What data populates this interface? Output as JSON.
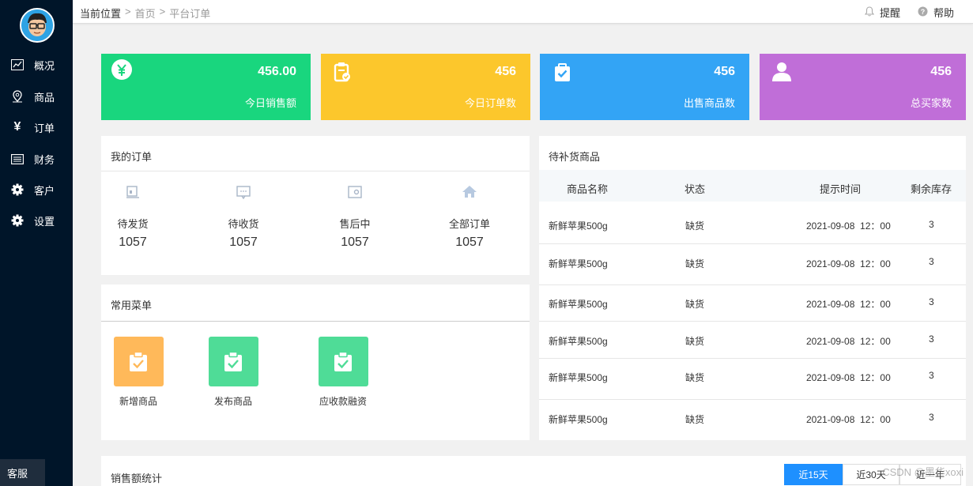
{
  "sidebar": {
    "items": [
      {
        "label": "概况",
        "icon": "chart-line-icon"
      },
      {
        "label": "商品",
        "icon": "map-pin-icon"
      },
      {
        "label": "订单",
        "icon": "yen-icon"
      },
      {
        "label": "财务",
        "icon": "list-icon"
      },
      {
        "label": "客户",
        "icon": "gear-icon"
      },
      {
        "label": "设置",
        "icon": "gear-icon"
      }
    ],
    "kefu": "客服"
  },
  "header": {
    "location_label": "当前位置",
    "crumbs": [
      "首页",
      "平台订单"
    ],
    "remind": "提醒",
    "help": "帮助"
  },
  "stats": [
    {
      "value": "456.00",
      "label": "今日销售额",
      "color": "#19d67e",
      "icon": "yen-circle-icon"
    },
    {
      "value": "456",
      "label": "今日订单数",
      "color": "#fcc72c",
      "icon": "clipboard-icon"
    },
    {
      "value": "456",
      "label": "出售商品数",
      "color": "#33a4f5",
      "icon": "bag-check-icon"
    },
    {
      "value": "456",
      "label": "总买家数",
      "color": "#c06ed8",
      "icon": "user-icon"
    }
  ],
  "orders": {
    "title": "我的订单",
    "items": [
      {
        "label": "待发货",
        "count": "1057"
      },
      {
        "label": "待收货",
        "count": "1057"
      },
      {
        "label": "售后中",
        "count": "1057"
      },
      {
        "label": "全部订单",
        "count": "1057"
      }
    ]
  },
  "menu": {
    "title": "常用菜单",
    "items": [
      {
        "label": "新增商品",
        "color": "#ffb95a"
      },
      {
        "label": "发布商品",
        "color": "#4fdc97"
      },
      {
        "label": "应收款融资",
        "color": "#4fdc97"
      }
    ]
  },
  "restock": {
    "title": "待补货商品",
    "headers": [
      "商品名称",
      "状态",
      "提示时间",
      "剩余库存"
    ],
    "rows": [
      [
        "新鲜苹果500g",
        "缺货",
        "2021-09-08  12：00",
        "3"
      ],
      [
        "新鲜苹果500g",
        "缺货",
        "2021-09-08  12：00",
        "3"
      ],
      [
        "新鲜苹果500g",
        "缺货",
        "2021-09-08  12：00",
        "3"
      ],
      [
        "新鲜苹果500g",
        "缺货",
        "2021-09-08  12：00",
        "3"
      ],
      [
        "新鲜苹果500g",
        "缺货",
        "2021-09-08  12：00",
        "3"
      ],
      [
        "新鲜苹果500g",
        "缺货",
        "2021-09-08  12：00",
        "3"
      ]
    ]
  },
  "sales": {
    "title": "销售额统计",
    "ranges": [
      "近15天",
      "近30天",
      "近一年"
    ],
    "active_range": "近15天"
  },
  "watermark": "CSDN @墨华xoxi"
}
